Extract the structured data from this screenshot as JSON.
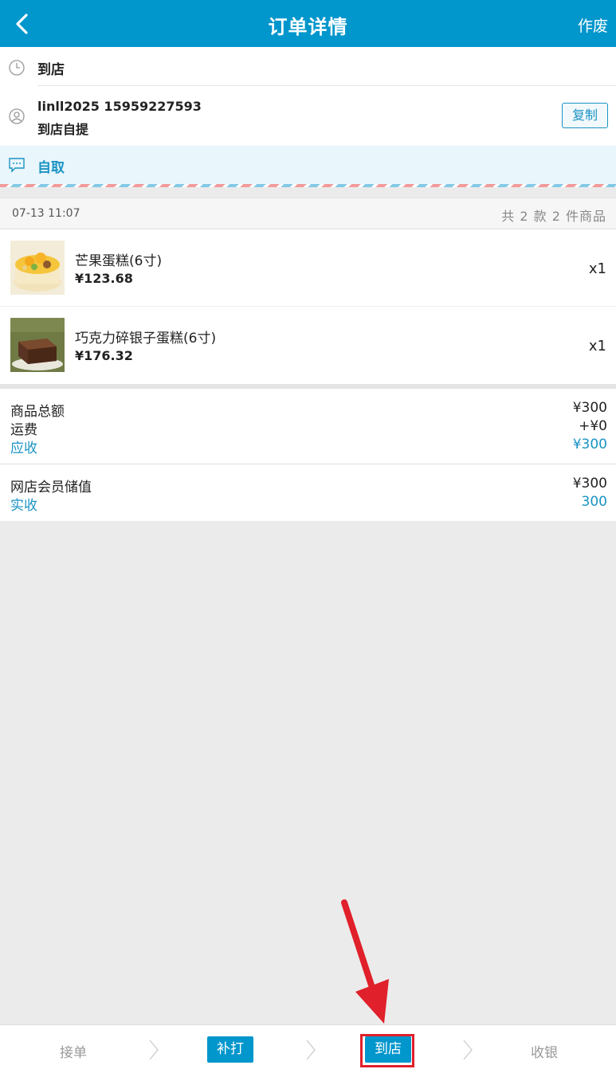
{
  "header": {
    "title": "订单详情",
    "void_label": "作废"
  },
  "info": {
    "status": "到店",
    "user_line1": "linll2025 15959227593",
    "user_line2": "到店自提",
    "copy_label": "复制",
    "pickup": "自取"
  },
  "order": {
    "time": "07-13 11:07",
    "count_text": "共 2 款 2 件商品"
  },
  "items": [
    {
      "name": "芒果蛋糕(6寸)",
      "price": "¥123.68",
      "qty": "x1"
    },
    {
      "name": "巧克力碎银子蛋糕(6寸)",
      "price": "¥176.32",
      "qty": "x1"
    }
  ],
  "summary": {
    "subtotal_label": "商品总额",
    "subtotal": "¥300",
    "shipping_label": "运费",
    "shipping": "+¥0",
    "receivable_label": "应收",
    "receivable": "¥300",
    "member_label": "网店会员储值",
    "member": "¥300",
    "received_label": "实收",
    "received": "300"
  },
  "steps": {
    "accept": "接单",
    "reprint": "补打",
    "arrive": "到店",
    "checkout": "收银"
  },
  "colors": {
    "primary": "#0196cc",
    "accent_text": "#1a93c4",
    "annotation": "#e0202a"
  }
}
